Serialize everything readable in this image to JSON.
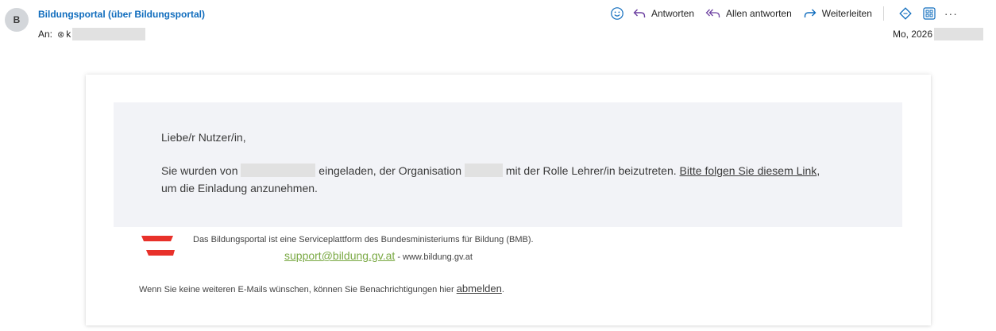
{
  "header": {
    "avatar_letter": "B",
    "sender": "Bildungsportal (über Bildungsportal)",
    "to_label": "An:",
    "recipient_icon": "⊗",
    "recipient_initial": "k",
    "date": "Mo, 2026"
  },
  "toolbar": {
    "emoji_icon": "smiley-icon",
    "reply_label": "Antworten",
    "reply_all_label": "Allen antworten",
    "forward_label": "Weiterleiten",
    "more_label": "···"
  },
  "email": {
    "greeting": "Liebe/r Nutzer/in,",
    "body_part1": "Sie wurden von",
    "body_part2": "eingeladen, der Organisation",
    "body_part3": "mit der Rolle Lehrer/in beizutreten.",
    "link_text": "Bitte folgen Sie diesem Link",
    "body_part4": ",",
    "body_line2": "um die Einladung anzunehmen.",
    "footer_line1": "Das Bildungsportal ist eine Serviceplattform des Bundesministeriums für Bildung (BMB).",
    "support_email": "support@bildung.gv.at",
    "footer_site": "- www.bildung.gv.at",
    "unsubscribe_text": "Wenn Sie keine weiteren E-Mails wünschen, können Sie Benachrichtigungen hier",
    "unsubscribe_link": "abmelden",
    "unsubscribe_end": "."
  },
  "colors": {
    "accent_link": "#0f6cbd",
    "toolbar_icon": "#6b3fa0",
    "logo_red": "#e8312a",
    "support_green": "#7aa944",
    "panel_bg": "#f2f3f7"
  }
}
